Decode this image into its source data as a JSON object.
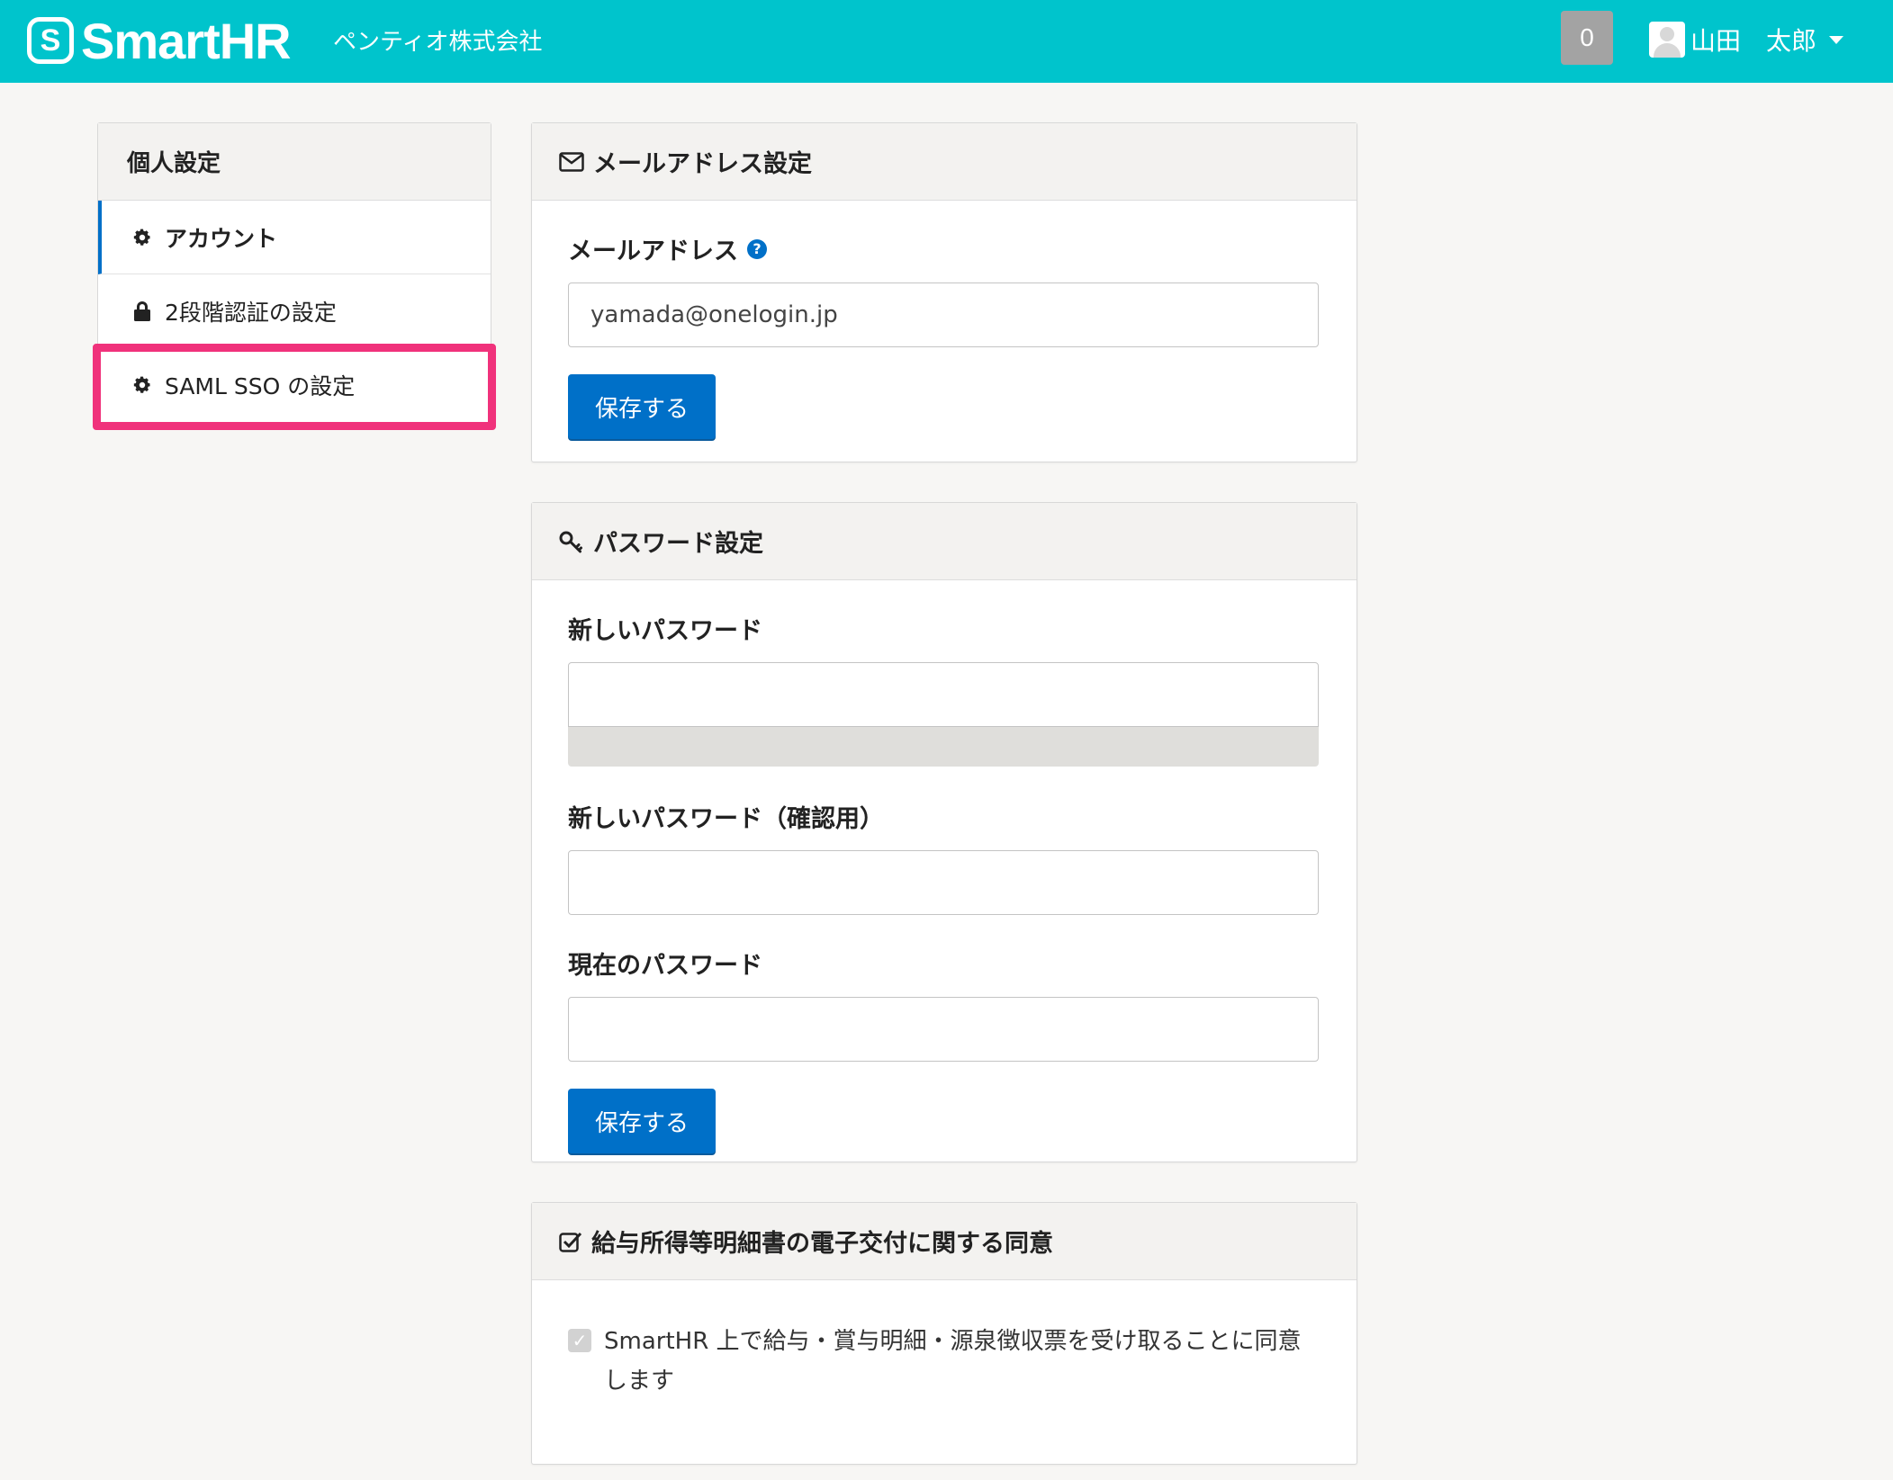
{
  "header": {
    "logo_mark": "S",
    "logo_text": "SmartHR",
    "company": "ペンティオ株式会社",
    "notification_count": "0",
    "user_name": "山田　太郎"
  },
  "sidebar": {
    "title": "個人設定",
    "items": [
      {
        "label": "アカウント",
        "icon": "gear-icon",
        "active": true
      },
      {
        "label": "2段階認証の設定",
        "icon": "lock-icon",
        "active": false
      },
      {
        "label": "SAML SSO の設定",
        "icon": "gear-icon",
        "active": false,
        "highlighted": true
      }
    ]
  },
  "email_panel": {
    "title": "メールアドレス設定",
    "icon": "envelope-icon",
    "field_label": "メールアドレス",
    "help_icon": "?",
    "email_value": "yamada@onelogin.jp",
    "save_label": "保存する"
  },
  "password_panel": {
    "title": "パスワード設定",
    "icon": "key-icon",
    "new_password_label": "新しいパスワード",
    "confirm_password_label": "新しいパスワード（確認用）",
    "current_password_label": "現在のパスワード",
    "save_label": "保存する"
  },
  "consent_panel": {
    "title": "給与所得等明細書の電子交付に関する同意",
    "icon": "check-square-icon",
    "checkbox_text": "SmartHR 上で給与・賞与明細・源泉徴収票を受け取ることに同意します",
    "checked": true
  },
  "colors": {
    "header_bg": "#00c4cc",
    "primary_button": "#0070c8",
    "highlight_border": "#f0327b",
    "page_bg": "#f7f6f4"
  }
}
